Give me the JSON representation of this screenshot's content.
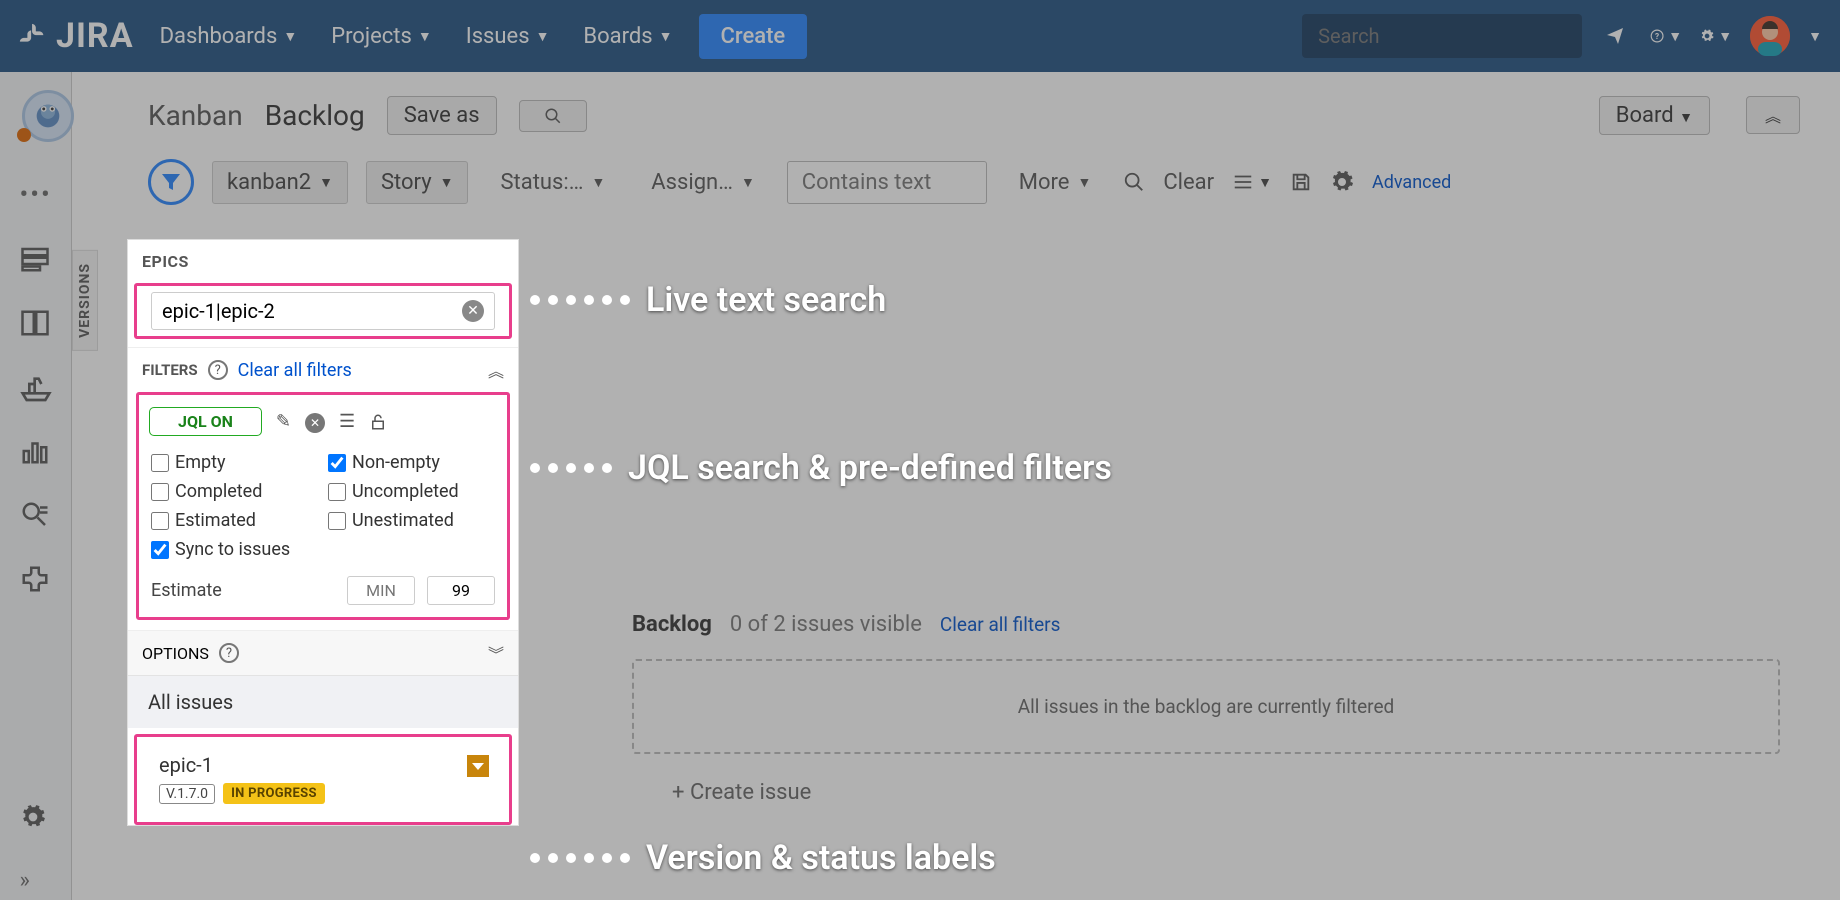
{
  "nav": {
    "brand": "JIRA",
    "items": [
      "Dashboards",
      "Projects",
      "Issues",
      "Boards"
    ],
    "create": "Create",
    "search_placeholder": "Search"
  },
  "header": {
    "crumb1": "Kanban",
    "crumb2": "Backlog",
    "save_as": "Save as",
    "board": "Board"
  },
  "filterbar": {
    "project": "kanban2",
    "type": "Story",
    "status": "Status:…",
    "assignee": "Assign…",
    "contains": "Contains text",
    "more": "More",
    "clear": "Clear",
    "advanced": "Advanced"
  },
  "versions_tab": "VERSIONS",
  "panel": {
    "epics_title": "EPICS",
    "search_value": "epic-1|epic-2",
    "filters_title": "FILTERS",
    "clear_all": "Clear all filters",
    "jql": "JQL ON",
    "cb": {
      "empty": "Empty",
      "nonempty": "Non-empty",
      "completed": "Completed",
      "uncompleted": "Uncompleted",
      "estimated": "Estimated",
      "unestimated": "Unestimated",
      "sync": "Sync to issues"
    },
    "estimate_label": "Estimate",
    "min_placeholder": "MIN",
    "max_value": "99",
    "options_title": "OPTIONS",
    "all_issues": "All issues",
    "epic1": {
      "name": "epic-1",
      "version": "V.1.7.0",
      "status": "IN PROGRESS"
    }
  },
  "backlog": {
    "title": "Backlog",
    "count": "0 of 2 issues visible",
    "clear": "Clear all filters",
    "empty_msg": "All issues in the backlog are currently filtered",
    "create": "+   Create issue"
  },
  "annotations": {
    "a1": "Live text search",
    "a2": "JQL search & pre-defined filters",
    "a3": "Version & status labels"
  }
}
